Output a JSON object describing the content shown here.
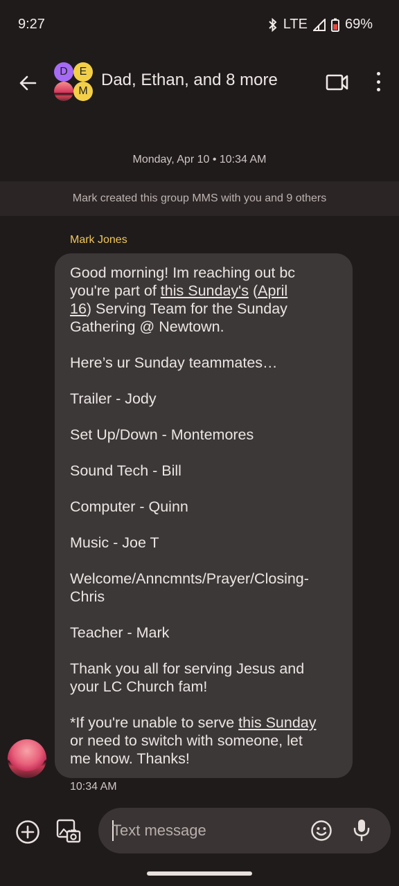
{
  "status_bar": {
    "time": "9:27",
    "network": "LTE",
    "battery": "69%"
  },
  "header": {
    "avatars": [
      "D",
      "E",
      "M"
    ],
    "title": "Dad, Ethan, and 8 more",
    "icons": [
      "back-arrow-icon",
      "video-call-icon",
      "more-options-icon"
    ]
  },
  "thread": {
    "date_separator": "Monday, Apr 10 • 10:34 AM",
    "system_notice": "Mark created this group MMS with you and 9 others",
    "message": {
      "sender": "Mark Jones",
      "time": "10:34 AM",
      "lines": {
        "l1": "Good morning! Im reaching out bc",
        "l2a": "you're part of ",
        "l2b": "this Sunday's",
        "l2c": " (",
        "l2d": "April",
        "l3a": "16",
        "l3b": ") Serving Team for the Sunday",
        "l4": "Gathering @ Newtown.",
        "l5": "Here’s ur Sunday teammates…",
        "l6": "Trailer - Jody",
        "l7": "Set Up/Down - Montemores",
        "l8": "Sound Tech - Bill",
        "l9": "Computer - Quinn",
        "l10": "Music - Joe T",
        "l11": "Welcome/Anncmnts/Prayer/Closing-",
        "l12": "Chris",
        "l13": "Teacher - Mark",
        "l14": "Thank you all for serving Jesus and",
        "l15": "your LC Church fam!",
        "l16a": "*If you're unable to serve ",
        "l16b": "this Sunday",
        "l17": "or need to switch with someone, let",
        "l18": "me know. Thanks!"
      }
    }
  },
  "compose": {
    "placeholder": "Text message",
    "value": "",
    "icons": [
      "add-icon",
      "gallery-icon",
      "emoji-icon",
      "mic-icon"
    ]
  },
  "colors": {
    "background": "#1f1b1b",
    "bubble": "#3b3837",
    "sender_name": "#f0c75a",
    "avatar_d": "#a56bf5",
    "avatar_e_m": "#f3cf48"
  }
}
